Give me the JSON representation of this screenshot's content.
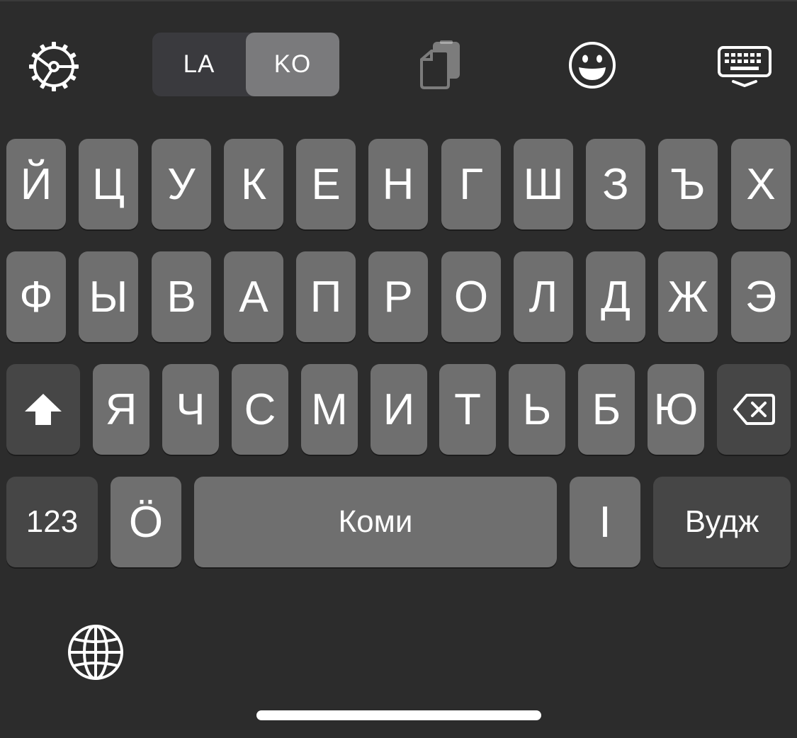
{
  "toolbar": {
    "settings_icon": "gear-icon",
    "lang_left": "LA",
    "lang_right": "KO",
    "active_lang": "KO",
    "clipboard_icon": "clipboard-icon",
    "emoji_icon": "emoji-icon",
    "keyboard_hide_icon": "keyboard-dismiss-icon"
  },
  "keyboard": {
    "row1": [
      "Й",
      "Ц",
      "У",
      "К",
      "Е",
      "Н",
      "Г",
      "Ш",
      "З",
      "Ъ",
      "Х"
    ],
    "row2": [
      "Ф",
      "Ы",
      "В",
      "А",
      "П",
      "Р",
      "О",
      "Л",
      "Д",
      "Ж",
      "Э"
    ],
    "row3": [
      "Я",
      "Ч",
      "С",
      "М",
      "И",
      "Т",
      "Ь",
      "Б",
      "Ю"
    ],
    "shift_icon": "shift-icon",
    "backspace_icon": "backspace-icon",
    "numbers_label": "123",
    "o_umlaut_label": "Ö",
    "space_label": "Коми",
    "i_label": "І",
    "return_label": "Вудж",
    "globe_icon": "globe-icon"
  },
  "colors": {
    "background": "#2c2c2c",
    "letter_key": "#6f6f6f",
    "function_key": "#464646",
    "active_segment": "#7a7a7c",
    "text": "#ffffff"
  }
}
